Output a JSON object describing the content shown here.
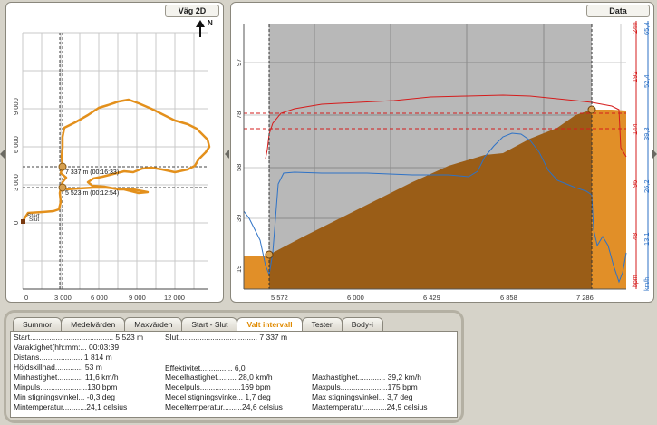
{
  "map": {
    "title": "Väg 2D",
    "north_label": "N",
    "x_ticks": [
      "0",
      "3 000",
      "6 000",
      "9 000",
      "12 000"
    ],
    "y_ticks": [
      "0",
      "3 000",
      "6 000",
      "9 000"
    ],
    "start_label": "Start",
    "end_label": "Slut",
    "marker1_label": "7 337 m (00:16:33)",
    "marker2_label": "5 523 m (00:12:54)",
    "route_color": "#e3901c"
  },
  "data_panel": {
    "title": "Data",
    "alt_ticks": [
      "97",
      "78",
      "58",
      "39",
      "19"
    ],
    "x_ticks": [
      "5 572",
      "6 000",
      "6 429",
      "6 858",
      "7 286"
    ],
    "hr_ticks": [
      "240",
      "192",
      "144",
      "96",
      "48"
    ],
    "hr_unit": "bpm",
    "speed_ticks": [
      "65,4",
      "52,4",
      "39,3",
      "26,2",
      "13,1"
    ],
    "speed_unit": "km/h",
    "colors": {
      "altitude": "#9a5d17",
      "altitude_outside": "#e18f28",
      "heart_rate": "#d51c1c",
      "speed": "#2e72c6",
      "selection": "#b8b8b8"
    }
  },
  "tabs": [
    "Summor",
    "Medelvärden",
    "Maxvärden",
    "Start - Slut",
    "Valt intervall",
    "Tester",
    "Body-i"
  ],
  "active_tab": "Valt intervall",
  "stats": {
    "start": "Start.......................................  5 523 m",
    "slut": "Slut.....................................  7 337 m",
    "varaktighet": "Varaktighet(hh:mm:... 00:03:39",
    "distans": "Distans....................  1 814 m",
    "hojdskillnad": "Höjdskillnad.............  53 m",
    "effektivitet": "Effektivitet...............  6,0",
    "minhastighet": "Minhastighet............  11,6 km/h",
    "medelhastighet": "Medelhastighet.........  28,0 km/h",
    "maxhastighet": "Maxhastighet.............  39,2 km/h",
    "minpuls": "Minpuls......................130 bpm",
    "medelpuls": "Medelpuls...................169 bpm",
    "maxpuls": "Maxpuls......................175 bpm",
    "min_stigning": "Min stigningsvinkel... -0,3 deg",
    "medel_stigning": "Medel stigningsvinke... 1,7 deg",
    "max_stigning": "Max stigningsvinkel... 3,7 deg",
    "mintemp": "Mintemperatur...........24,1 celsius",
    "medeltemp": "Medeltemperatur.........24,6 celsius",
    "maxtemp": "Maxtemperatur...........24,9 celsius"
  }
}
